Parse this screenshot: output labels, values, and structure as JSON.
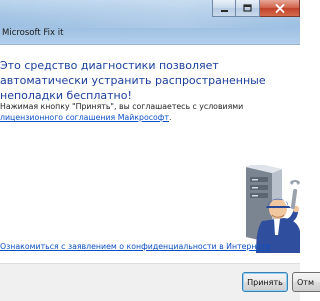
{
  "window": {
    "title": "Microsoft Fix it",
    "controls": [
      "minimize-icon",
      "maximize-icon",
      "close-icon"
    ]
  },
  "content": {
    "headline": "Это средство диагностики позволяет автоматически устранить распространенные неполадки бесплатно!",
    "agreement_prefix": "Нажимая кнопку \"Принять\", вы соглашаетесь с условиями ",
    "agreement_link": "лицензионного соглашения Майкрософт",
    "agreement_suffix": ".",
    "privacy_link": "Ознакомиться с заявлением о конфиденциальности в Интернете",
    "illustration_icon": "technician-server-wrench-icon"
  },
  "footer": {
    "accept_label": "Принять",
    "cancel_label": "Отм"
  },
  "colors": {
    "headline": "#1a3f9b",
    "link": "#0b4fc6",
    "titlebar": "#a9c8e6"
  }
}
